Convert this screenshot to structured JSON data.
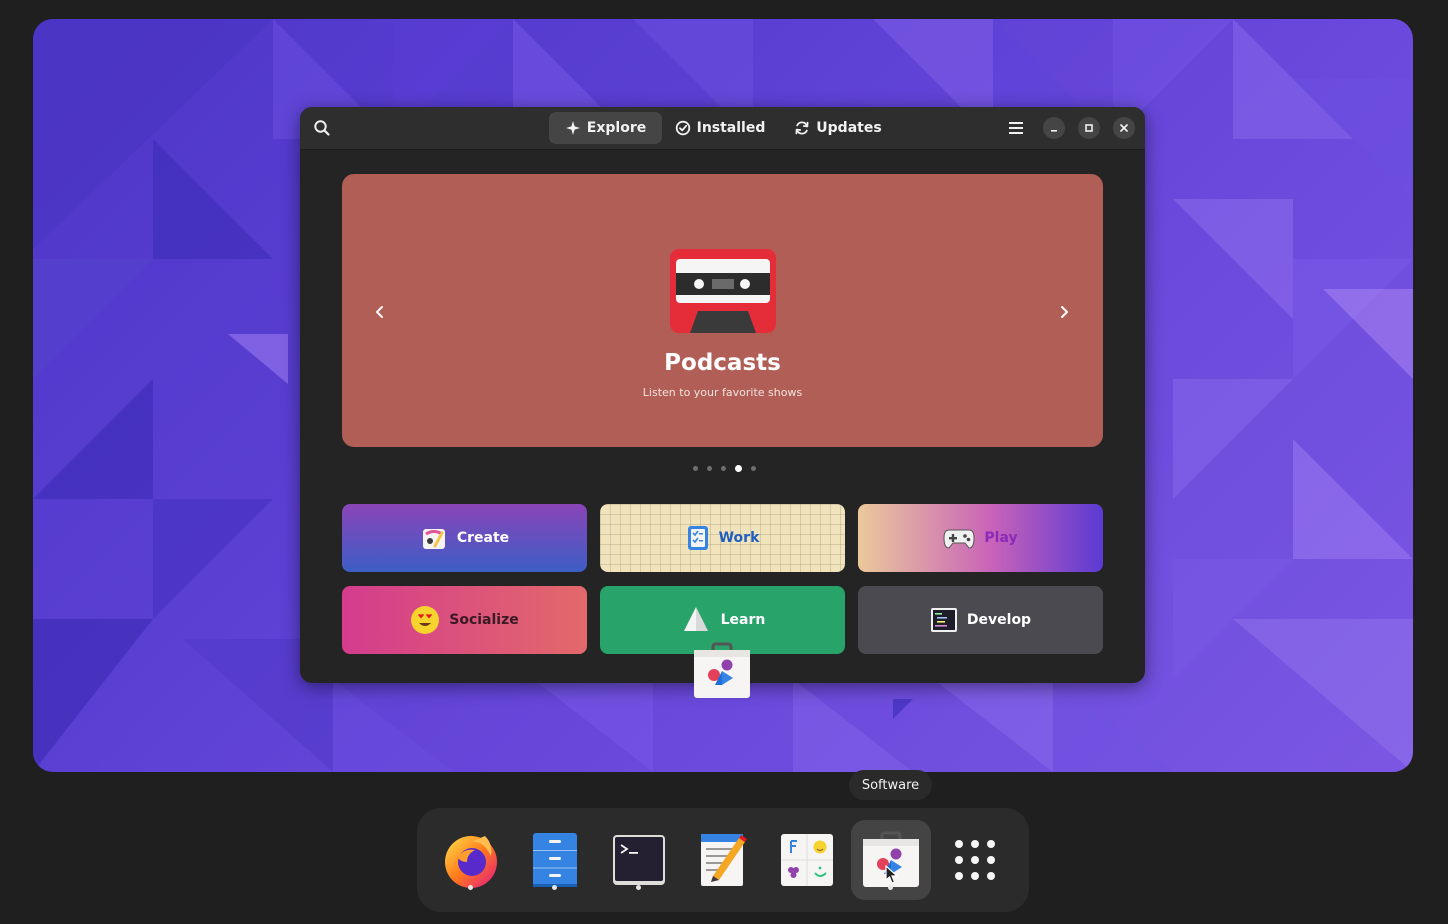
{
  "window": {
    "tabs": [
      {
        "label": "Explore",
        "active": true
      },
      {
        "label": "Installed",
        "active": false
      },
      {
        "label": "Updates",
        "active": false
      }
    ]
  },
  "banner": {
    "title": "Podcasts",
    "subtitle": "Listen to your favorite shows",
    "background": "#b05e56",
    "page_count": 5,
    "active_page": 4
  },
  "categories": [
    {
      "label": "Create",
      "icon": "paint-palette-icon"
    },
    {
      "label": "Work",
      "icon": "checklist-icon"
    },
    {
      "label": "Play",
      "icon": "gamepad-icon"
    },
    {
      "label": "Socialize",
      "icon": "heart-eyes-emoji-icon"
    },
    {
      "label": "Learn",
      "icon": "sailboat-icon"
    },
    {
      "label": "Develop",
      "icon": "code-editor-icon"
    }
  ],
  "dock": {
    "tooltip": "Software",
    "apps": [
      {
        "name": "Firefox",
        "icon": "firefox-icon",
        "running": true
      },
      {
        "name": "Files",
        "icon": "file-cabinet-icon",
        "running": true
      },
      {
        "name": "Terminal",
        "icon": "terminal-icon",
        "running": true
      },
      {
        "name": "Text Editor",
        "icon": "text-editor-icon",
        "running": false
      },
      {
        "name": "Characters",
        "icon": "characters-icon",
        "running": false
      },
      {
        "name": "Software",
        "icon": "software-bag-icon",
        "running": true
      },
      {
        "name": "Show Apps",
        "icon": "app-grid-icon",
        "running": false
      }
    ]
  },
  "colors": {
    "wallpaper": "#5b3fd3",
    "window_bg": "#242424",
    "headerbar": "#2e2e2e",
    "dock": "#2b2b2b"
  }
}
